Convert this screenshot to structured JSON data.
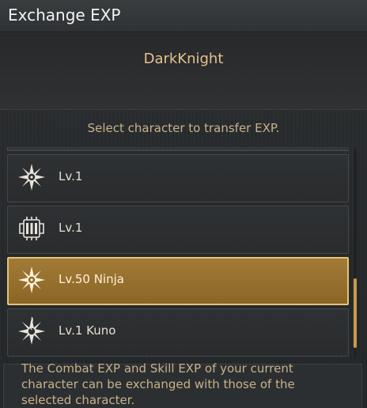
{
  "window": {
    "title": "Exchange EXP"
  },
  "header": {
    "character_name": "DarkKnight"
  },
  "instruction": "Select character to transfer EXP.",
  "characters": [
    {
      "label": "Lv.1",
      "icon": "shuriken-icon",
      "selected": false
    },
    {
      "label": "Lv.1",
      "icon": "fortress-icon",
      "selected": false
    },
    {
      "label": "Lv.50 Ninja",
      "icon": "shuriken-icon",
      "selected": true
    },
    {
      "label": "Lv.1 Kuno",
      "icon": "kunoichi-shuriken-icon",
      "selected": false
    }
  ],
  "info": "The Combat EXP and Skill EXP of your current character can be exchanged with those of the selected character.",
  "colors": {
    "accent": "#e7c28d",
    "selected_bg": "#9a7431",
    "selected_border": "#e4c27b"
  }
}
